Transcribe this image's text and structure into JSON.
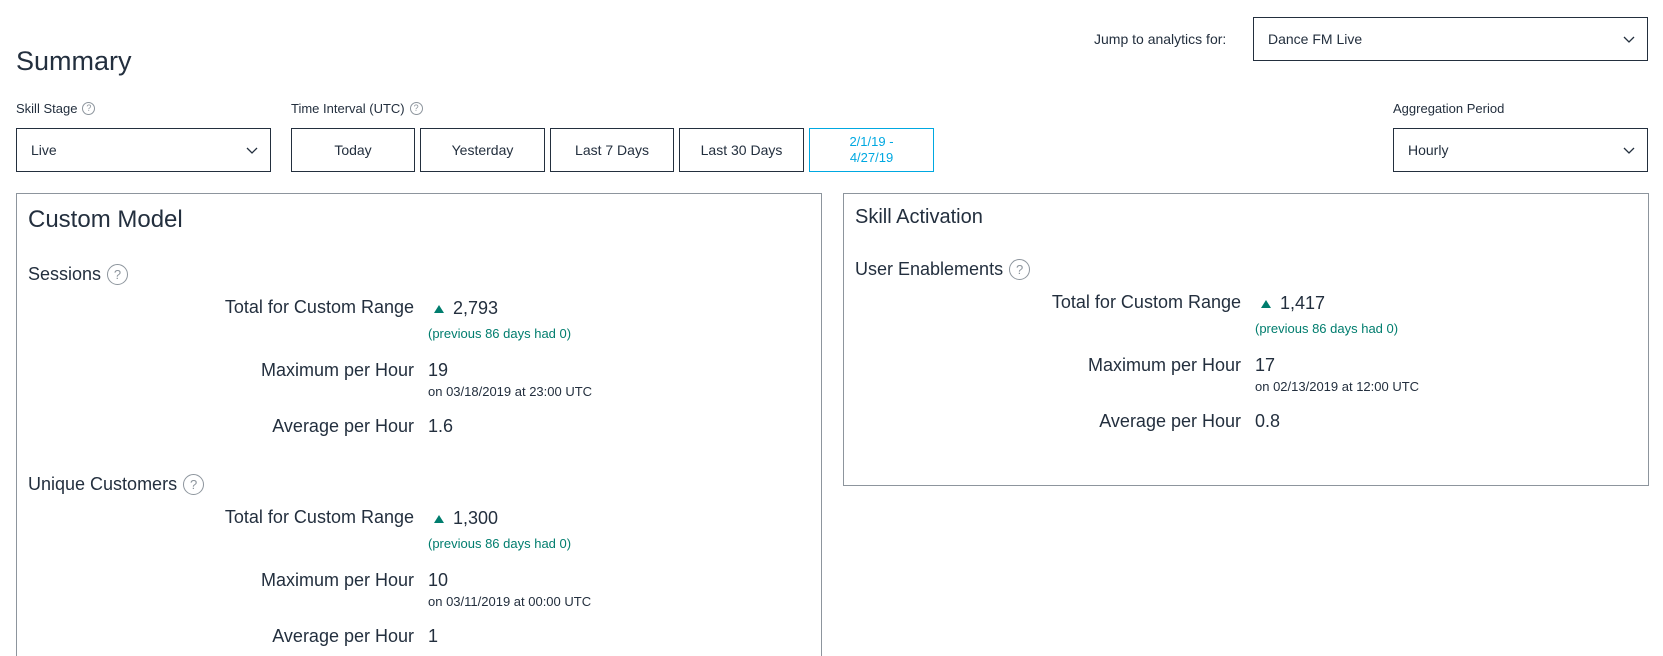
{
  "page": {
    "title": "Summary",
    "jump_label": "Jump to analytics for:",
    "jump_value": "Dance FM Live"
  },
  "filters": {
    "skill_stage_label": "Skill Stage",
    "skill_stage_value": "Live",
    "time_interval_label": "Time Interval (UTC)",
    "time_buttons": [
      "Today",
      "Yesterday",
      "Last 7 Days",
      "Last 30 Days"
    ],
    "custom_range_line1": "2/1/19 -",
    "custom_range_line2": "4/27/19",
    "aggregation_label": "Aggregation Period",
    "aggregation_value": "Hourly",
    "help_glyph": "?"
  },
  "custom_model": {
    "title": "Custom Model",
    "sessions": {
      "title": "Sessions",
      "total_label": "Total for Custom Range",
      "total_value": "2,793",
      "total_note": "(previous 86 days had 0)",
      "max_label": "Maximum per Hour",
      "max_value": "19",
      "max_note": "on 03/18/2019 at 23:00 UTC",
      "avg_label": "Average per Hour",
      "avg_value": "1.6"
    },
    "unique_customers": {
      "title": "Unique Customers",
      "total_label": "Total for Custom Range",
      "total_value": "1,300",
      "total_note": "(previous 86 days had 0)",
      "max_label": "Maximum per Hour",
      "max_value": "10",
      "max_note": "on 03/11/2019 at 00:00 UTC",
      "avg_label": "Average per Hour",
      "avg_value": "1"
    }
  },
  "skill_activation": {
    "title": "Skill Activation",
    "user_enablements": {
      "title": "User Enablements",
      "total_label": "Total for Custom Range",
      "total_value": "1,417",
      "total_note": "(previous 86 days had 0)",
      "max_label": "Maximum per Hour",
      "max_value": "17",
      "max_note": "on 02/13/2019 at 12:00 UTC",
      "avg_label": "Average per Hour",
      "avg_value": "0.8"
    }
  },
  "colors": {
    "text": "#232f3e",
    "trend_up": "#007d6e",
    "active_range": "#00a8e1",
    "panel_border": "#8d959d"
  },
  "icons": {
    "dropdown": "chevron-down-icon",
    "help": "help-circle-icon",
    "trend": "trend-up-icon"
  }
}
